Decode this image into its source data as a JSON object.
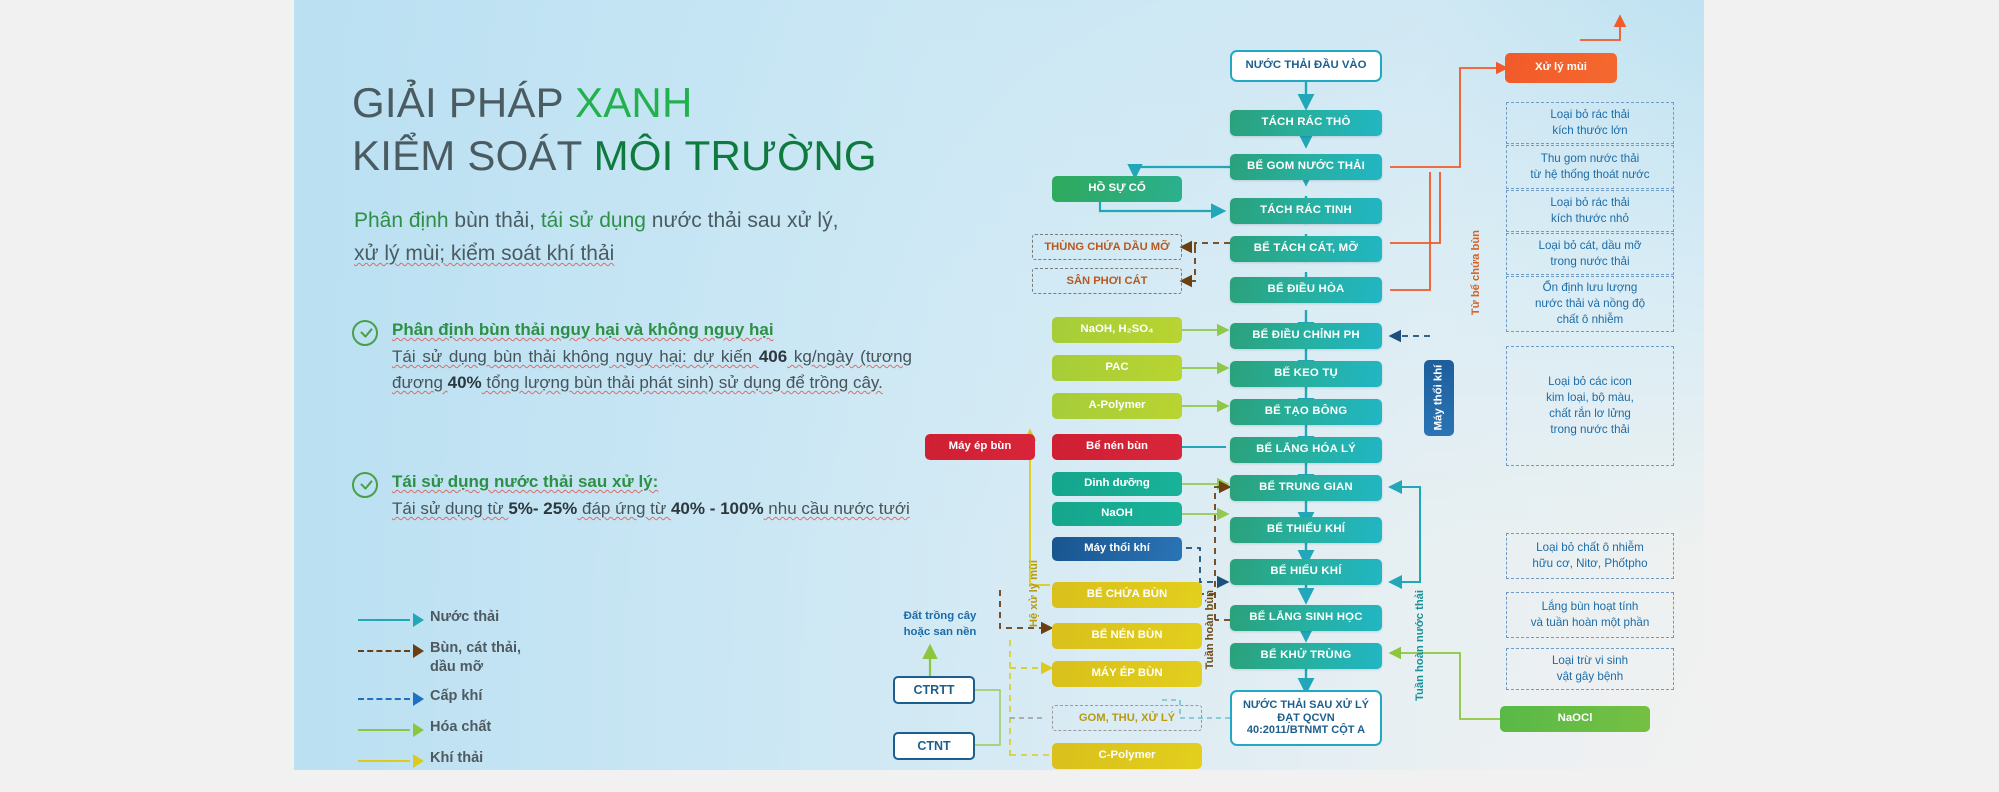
{
  "header": {
    "title_line1_a": "GIẢI PHÁP ",
    "title_line1_b": "XANH",
    "title_line2_a": "KIỂM SOÁT ",
    "title_line2_b": "MÔI TRƯỜNG",
    "subtitle_a": "Phân định",
    "subtitle_b": " bùn thải, ",
    "subtitle_c": "tái sử dụng",
    "subtitle_d": " nước thải sau xử lý,",
    "subtitle_e": "xử lý mùi; kiểm soát khí thải"
  },
  "bullets": [
    {
      "heading": "Phân định bùn thải nguy hại và không nguy hại",
      "body_1": "Tái sử dụng bùn thải không nguy hại: dự kiến ",
      "body_strong_1": "406",
      "body_2": " kg/ngày (tương đương ",
      "body_strong_2": "40%",
      "body_3": " tổng lượng bùn thải phát sinh) sử dụng để trồng cây."
    },
    {
      "heading": "Tái sử dụng nước thải sau xử lý:",
      "body_1": "Tái sử dụng từ ",
      "body_strong_1": "5%- 25%",
      "body_2": " đáp ứng từ ",
      "body_strong_2": "40% - 100%",
      "body_3": " nhu cầu nước tưới"
    }
  ],
  "legend": {
    "items": [
      {
        "label": "Nước thải",
        "color": "#22a7b8",
        "style": "solid"
      },
      {
        "label": "Bùn, cát thải,\ndầu mỡ",
        "label_l1": "Bùn, cát thải,",
        "label_l2": "dầu mỡ",
        "color": "#6b3f12",
        "style": "dashed"
      },
      {
        "label": "Cấp khí",
        "color": "#1f6fc4",
        "style": "dashed"
      },
      {
        "label": "Hóa chất",
        "color": "#8cc63f",
        "style": "solid"
      },
      {
        "label": "Khí thải",
        "color": "#dccb1c",
        "style": "solid"
      }
    ]
  },
  "flow": {
    "main_column": [
      {
        "id": "inflow",
        "label": "NƯỚC THẢI ĐẦU VÀO",
        "type": "inflow"
      },
      {
        "id": "tach-rac-tho",
        "label": "TÁCH RÁC THÔ",
        "type": "main"
      },
      {
        "id": "be-gom-nuoc-thai",
        "label": "BỂ GOM NƯỚC THẢI",
        "type": "main"
      },
      {
        "id": "tach-rac-tinh",
        "label": "TÁCH RÁC TINH",
        "type": "main"
      },
      {
        "id": "be-tach-cat-mo",
        "label": "BỂ TÁCH CÁT, MỠ",
        "type": "main"
      },
      {
        "id": "be-dieu-hoa",
        "label": "BỂ ĐIỀU HÒA",
        "type": "main"
      },
      {
        "id": "be-dieu-chinh-ph",
        "label": "BỂ ĐIỀU CHỈNH PH",
        "type": "main"
      },
      {
        "id": "be-keo-tu",
        "label": "BỂ KEO TỤ",
        "type": "main"
      },
      {
        "id": "be-tao-bong",
        "label": "BỂ TẠO BÔNG",
        "type": "main"
      },
      {
        "id": "be-lang-hoa-ly",
        "label": "BỂ LẮNG HÓA LÝ",
        "type": "main"
      },
      {
        "id": "be-trung-gian",
        "label": "BỂ TRUNG GIAN",
        "type": "main"
      },
      {
        "id": "be-thieu-khi",
        "label": "BỂ THIẾU KHÍ",
        "type": "main"
      },
      {
        "id": "be-hieu-khi",
        "label": "BỂ HIẾU KHÍ",
        "type": "main"
      },
      {
        "id": "be-lang-sinh-hoc",
        "label": "BỂ LẮNG SINH HỌC",
        "type": "main"
      },
      {
        "id": "be-khu-trung",
        "label": "BỂ KHỬ TRÙNG",
        "type": "main"
      }
    ],
    "outflow": {
      "line1": "NƯỚC THẢI SAU XỬ LÝ",
      "line2": "ĐẠT QCVN",
      "line3": "40:2011/BTNMT CỘT A"
    },
    "left_column": [
      {
        "id": "ho-su-co",
        "label": "HỒ SỰ CỐ",
        "type": "green"
      },
      {
        "id": "thung-chua-dau-mo",
        "label": "THÙNG CHỨA DẦU MỠ",
        "type": "dash"
      },
      {
        "id": "san-phoi-cat",
        "label": "SÂN PHƠI CÁT",
        "type": "dash"
      },
      {
        "id": "naoh-h2so4",
        "label": "NaOH, H₂SO₄",
        "type": "chem"
      },
      {
        "id": "pac",
        "label": "PAC",
        "type": "chem"
      },
      {
        "id": "a-polymer",
        "label": "A-Polymer",
        "type": "chem"
      },
      {
        "id": "be-nen-bun-red",
        "label": "Bể nén bùn",
        "type": "red"
      },
      {
        "id": "dinh-duong",
        "label": "Dinh dưỡng",
        "type": "teal"
      },
      {
        "id": "naoh",
        "label": "NaOH",
        "type": "teal"
      },
      {
        "id": "may-thoi-khi",
        "label": "Máy thổi khí",
        "type": "blue"
      },
      {
        "id": "be-chua-bun",
        "label": "BỂ CHỨA BÙN",
        "type": "yellow"
      },
      {
        "id": "be-nen-bun",
        "label": "BỂ NÉN BÙN",
        "type": "yellow"
      },
      {
        "id": "may-ep-bun",
        "label": "MÁY ÉP BÙN",
        "type": "yellow"
      },
      {
        "id": "gom-thu-xu-ly",
        "label": "GOM, THU, XỬ LÝ",
        "type": "dash"
      },
      {
        "id": "c-polymer",
        "label": "C-Polymer",
        "type": "yellow"
      }
    ],
    "may_ep_bun_red": "Máy ép bùn",
    "xu_ly_mui": "Xử lý mùi",
    "may_thoi_khi_vertical": "Máy thổi khí",
    "naocl": "NaOCl",
    "ctrtt": "CTRTT",
    "ctnt": "CTNT",
    "dat_trong_cay_l1": "Đất trồng cây",
    "dat_trong_cay_l2": "hoặc san nền"
  },
  "edge_labels": {
    "tu_be_chua_bun": "Từ bể chứa bùn",
    "tuan_hoan_bun": "Tuần hoàn bùn",
    "tuan_hoan_nuoc_thai": "Tuần hoàn nước thải",
    "he_xu_ly_mui": "Hệ xử lý mùi"
  },
  "annotations": [
    {
      "id": "anno-1",
      "line1": "Loại bỏ rác thải",
      "line2": "kích thước lớn"
    },
    {
      "id": "anno-2",
      "line1": "Thu gom nước thải",
      "line2": "từ hệ thống thoát nước"
    },
    {
      "id": "anno-3",
      "line1": "Loại bỏ rác thải",
      "line2": "kích thước nhỏ"
    },
    {
      "id": "anno-4",
      "line1": "Loại bỏ cát, dầu mỡ",
      "line2": "trong nước thải"
    },
    {
      "id": "anno-5",
      "line1": "Ổn định lưu lượng",
      "line2": "nước thải và nồng độ",
      "line3": "chất ô nhiễm"
    },
    {
      "id": "anno-6",
      "line1": "Loại bỏ các icon",
      "line2": "kim loại, bộ màu,",
      "line3": "chất rắn lơ lửng",
      "line4": "trong nước thải"
    },
    {
      "id": "anno-7",
      "line1": "Loại bỏ chất ô nhiễm",
      "line2": "hữu cơ, Nitơ, Phốtpho"
    },
    {
      "id": "anno-8",
      "line1": "Lắng bùn hoạt tính",
      "line2": "và tuần hoàn một phần"
    },
    {
      "id": "anno-9",
      "line1": "Loại trừ vi sinh",
      "line2": "vật gây bệnh"
    }
  ],
  "colors": {
    "brand_green": "#22b14c",
    "dark_green": "#0f7a3d",
    "teal": "#22a7b8",
    "orange": "#f15a29",
    "navy": "#1c5f8e",
    "yellow": "#d9c01c",
    "red": "#cf1f33"
  }
}
